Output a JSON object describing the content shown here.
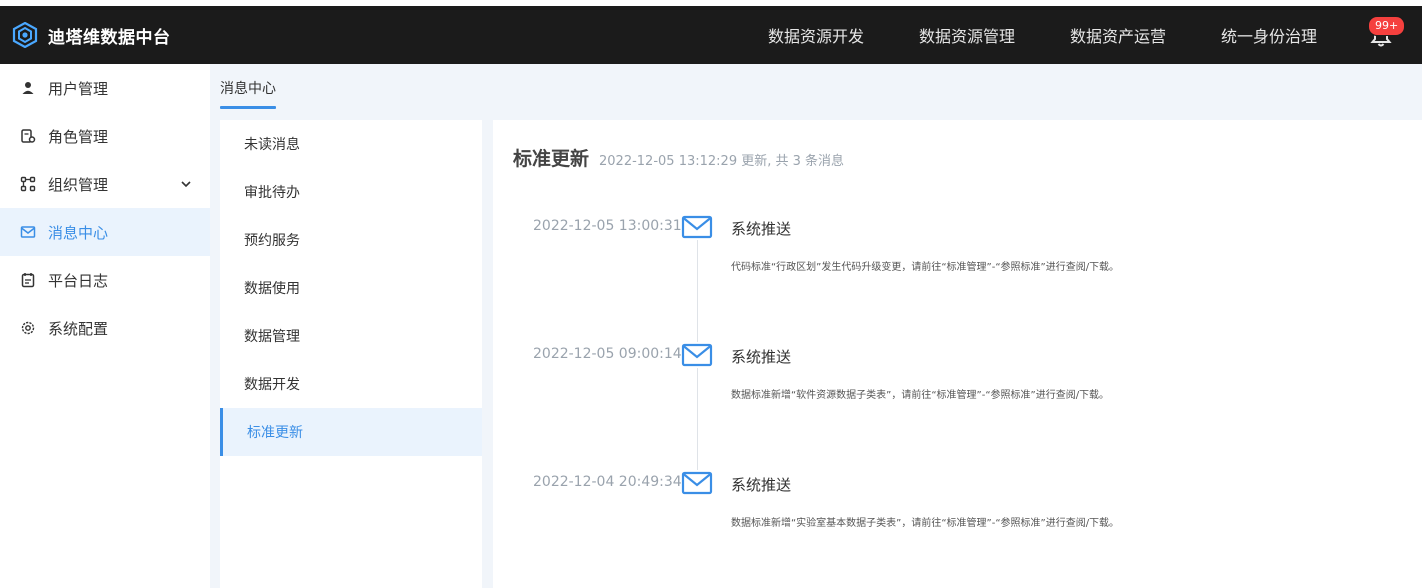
{
  "header": {
    "brand": "迪塔维数据中台",
    "nav": [
      "数据资源开发",
      "数据资源管理",
      "数据资产运营",
      "统一身份治理"
    ],
    "badge": "99+"
  },
  "sidebar": {
    "items": [
      {
        "label": "用户管理",
        "icon": "user-icon"
      },
      {
        "label": "角色管理",
        "icon": "role-icon"
      },
      {
        "label": "组织管理",
        "icon": "org-icon"
      },
      {
        "label": "消息中心",
        "icon": "mail-icon"
      },
      {
        "label": "平台日志",
        "icon": "log-icon"
      },
      {
        "label": "系统配置",
        "icon": "settings-icon"
      }
    ],
    "active": "消息中心"
  },
  "main": {
    "tab": "消息中心",
    "categories": [
      "未读消息",
      "审批待办",
      "预约服务",
      "数据使用",
      "数据管理",
      "数据开发",
      "标准更新"
    ],
    "active_category": "标准更新",
    "content": {
      "title": "标准更新",
      "meta": "2022-12-05 13:12:29 更新, 共 3 条消息",
      "messages": [
        {
          "time": "2022-12-05 13:00:31",
          "sender": "系统推送",
          "body": "代码标准“行政区划”发生代码升级变更，请前往“标准管理”-“参照标准”进行查阅/下载。"
        },
        {
          "time": "2022-12-05 09:00:14",
          "sender": "系统推送",
          "body": "数据标准新增“软件资源数据子类表”，请前往“标准管理”-“参照标准”进行查阅/下载。"
        },
        {
          "time": "2022-12-04 20:49:34",
          "sender": "系统推送",
          "body": "数据标准新增“实验室基本数据子类表”，请前往“标准管理”-“参照标准”进行查阅/下载。"
        }
      ]
    }
  },
  "colors": {
    "accent": "#3a8ee6",
    "topbar": "#1b1b1b",
    "badge": "#f5403e"
  }
}
